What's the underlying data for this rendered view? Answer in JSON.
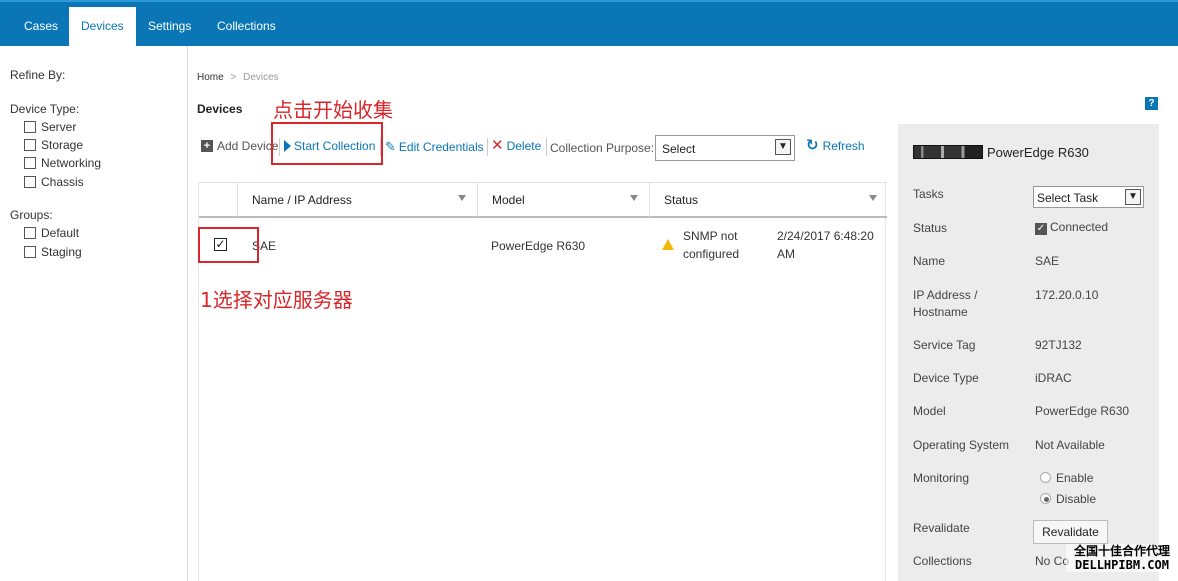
{
  "nav": {
    "tabs": [
      "Cases",
      "Devices",
      "Settings",
      "Collections"
    ],
    "active": "Devices"
  },
  "sidebar": {
    "refine_by": "Refine By:",
    "device_type_label": "Device Type:",
    "device_types": [
      "Server",
      "Storage",
      "Networking",
      "Chassis"
    ],
    "groups_label": "Groups:",
    "groups": [
      "Default",
      "Staging"
    ]
  },
  "breadcrumb": {
    "home": "Home",
    "separator": ">",
    "current": "Devices"
  },
  "page_title": "Devices",
  "help_icon_text": "?",
  "toolbar": {
    "add_device": "Add Device",
    "start_collection": "Start Collection",
    "edit_credentials": "Edit Credentials",
    "delete": "Delete",
    "purpose_label": "Collection Purpose:",
    "purpose_value": "Select",
    "refresh": "Refresh"
  },
  "table": {
    "columns": [
      "Name / IP Address",
      "Model",
      "Status"
    ],
    "rows": [
      {
        "checked": true,
        "name": "SAE",
        "model": "PowerEdge R630",
        "status_line1": "SNMP not",
        "status_line2": "configured",
        "time_line1": "2/24/2017 6:48:20",
        "time_line2": "AM"
      }
    ]
  },
  "details": {
    "title": "PowerEdge R630",
    "fields": [
      {
        "label": "Tasks",
        "value": "Select Task"
      },
      {
        "label": "Status",
        "value": "Connected"
      },
      {
        "label": "Name",
        "value": "SAE"
      },
      {
        "label_line1": "IP Address /",
        "label_line2": "Hostname",
        "value": "172.20.0.10"
      },
      {
        "label": "Service Tag",
        "value": "92TJ132"
      },
      {
        "label": "Device Type",
        "value": "iDRAC"
      },
      {
        "label": "Model",
        "value": "PowerEdge R630"
      },
      {
        "label": "Operating System",
        "value": "Not Available"
      },
      {
        "label": "Monitoring",
        "options": [
          "Enable",
          "Disable"
        ],
        "selected": "Disable"
      },
      {
        "label": "Revalidate",
        "button": "Revalidate"
      },
      {
        "label": "Collections",
        "value": "No Co"
      }
    ]
  },
  "annotations": {
    "start_hint": "点击开始收集",
    "select_hint": "1选择对应服务器"
  },
  "watermark": {
    "line1": "全国十佳合作代理",
    "line2": "DELLHPIBM.COM"
  },
  "colors": {
    "brand_blue": "#0a76b6",
    "annotation_red": "#d9262b",
    "panel_grey": "#ececec",
    "warning_yellow": "#f2b705"
  }
}
